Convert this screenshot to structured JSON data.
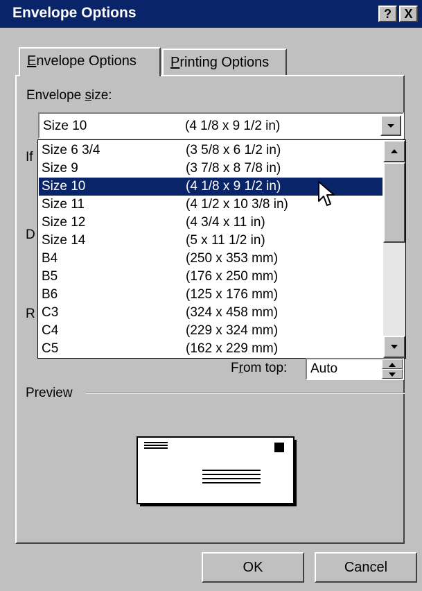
{
  "window": {
    "title": "Envelope Options",
    "help_button": "?",
    "close_button": "X"
  },
  "tabs": [
    {
      "label_pre": "",
      "label_key": "E",
      "label_post": "nvelope Options",
      "selected": true
    },
    {
      "label_pre": "",
      "label_key": "P",
      "label_post": "rinting Options",
      "selected": false
    }
  ],
  "envelope_size": {
    "label_pre": "Envelope ",
    "label_key": "s",
    "label_post": "ize:",
    "selected_name": "Size 10",
    "selected_dims": "(4 1/8 x 9 1/2 in)"
  },
  "size_list": [
    {
      "name": "Size 6 3/4",
      "dims": "(3 5/8 x 6 1/2 in)"
    },
    {
      "name": "Size 9",
      "dims": "(3 7/8 x 8 7/8 in)"
    },
    {
      "name": "Size 10",
      "dims": "(4 1/8 x 9 1/2 in)"
    },
    {
      "name": "Size 11",
      "dims": "(4 1/2 x 10 3/8 in)"
    },
    {
      "name": "Size 12",
      "dims": "(4 3/4 x 11 in)"
    },
    {
      "name": "Size 14",
      "dims": "(5 x 11 1/2 in)"
    },
    {
      "name": "B4",
      "dims": "(250 x 353 mm)"
    },
    {
      "name": "B5",
      "dims": "(176 x 250 mm)"
    },
    {
      "name": "B6",
      "dims": "(125 x 176 mm)"
    },
    {
      "name": "C3",
      "dims": "(324 x 458 mm)"
    },
    {
      "name": "C4",
      "dims": "(229 x 324 mm)"
    },
    {
      "name": "C5",
      "dims": "(162 x 229 mm)"
    }
  ],
  "selected_index": 2,
  "hidden_labels": {
    "if_label": "If",
    "d_label": "D",
    "r_label": "R"
  },
  "from_top": {
    "label_pre": "F",
    "label_key": "r",
    "label_post": "om top:",
    "value": "Auto"
  },
  "preview": {
    "label": "Preview"
  },
  "buttons": {
    "ok": "OK",
    "cancel": "Cancel"
  },
  "colors": {
    "title_bar": "#0a246a",
    "selection": "#0a246a",
    "face": "#c0c0c0"
  }
}
